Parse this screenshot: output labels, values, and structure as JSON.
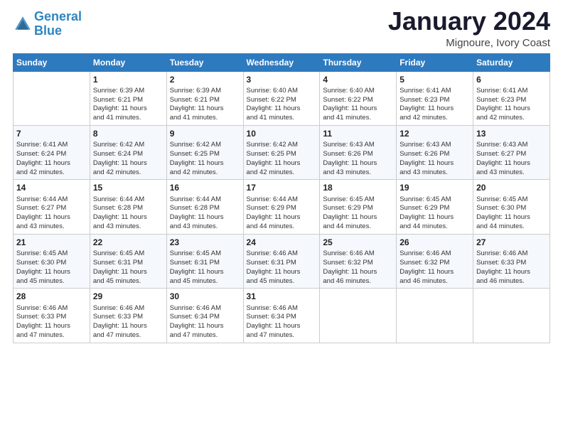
{
  "logo": {
    "line1": "General",
    "line2": "Blue"
  },
  "title": "January 2024",
  "subtitle": "Mignoure, Ivory Coast",
  "days_header": [
    "Sunday",
    "Monday",
    "Tuesday",
    "Wednesday",
    "Thursday",
    "Friday",
    "Saturday"
  ],
  "weeks": [
    [
      {
        "day": "",
        "info": ""
      },
      {
        "day": "1",
        "info": "Sunrise: 6:39 AM\nSunset: 6:21 PM\nDaylight: 11 hours\nand 41 minutes."
      },
      {
        "day": "2",
        "info": "Sunrise: 6:39 AM\nSunset: 6:21 PM\nDaylight: 11 hours\nand 41 minutes."
      },
      {
        "day": "3",
        "info": "Sunrise: 6:40 AM\nSunset: 6:22 PM\nDaylight: 11 hours\nand 41 minutes."
      },
      {
        "day": "4",
        "info": "Sunrise: 6:40 AM\nSunset: 6:22 PM\nDaylight: 11 hours\nand 41 minutes."
      },
      {
        "day": "5",
        "info": "Sunrise: 6:41 AM\nSunset: 6:23 PM\nDaylight: 11 hours\nand 42 minutes."
      },
      {
        "day": "6",
        "info": "Sunrise: 6:41 AM\nSunset: 6:23 PM\nDaylight: 11 hours\nand 42 minutes."
      }
    ],
    [
      {
        "day": "7",
        "info": "Sunrise: 6:41 AM\nSunset: 6:24 PM\nDaylight: 11 hours\nand 42 minutes."
      },
      {
        "day": "8",
        "info": "Sunrise: 6:42 AM\nSunset: 6:24 PM\nDaylight: 11 hours\nand 42 minutes."
      },
      {
        "day": "9",
        "info": "Sunrise: 6:42 AM\nSunset: 6:25 PM\nDaylight: 11 hours\nand 42 minutes."
      },
      {
        "day": "10",
        "info": "Sunrise: 6:42 AM\nSunset: 6:25 PM\nDaylight: 11 hours\nand 42 minutes."
      },
      {
        "day": "11",
        "info": "Sunrise: 6:43 AM\nSunset: 6:26 PM\nDaylight: 11 hours\nand 43 minutes."
      },
      {
        "day": "12",
        "info": "Sunrise: 6:43 AM\nSunset: 6:26 PM\nDaylight: 11 hours\nand 43 minutes."
      },
      {
        "day": "13",
        "info": "Sunrise: 6:43 AM\nSunset: 6:27 PM\nDaylight: 11 hours\nand 43 minutes."
      }
    ],
    [
      {
        "day": "14",
        "info": "Sunrise: 6:44 AM\nSunset: 6:27 PM\nDaylight: 11 hours\nand 43 minutes."
      },
      {
        "day": "15",
        "info": "Sunrise: 6:44 AM\nSunset: 6:28 PM\nDaylight: 11 hours\nand 43 minutes."
      },
      {
        "day": "16",
        "info": "Sunrise: 6:44 AM\nSunset: 6:28 PM\nDaylight: 11 hours\nand 43 minutes."
      },
      {
        "day": "17",
        "info": "Sunrise: 6:44 AM\nSunset: 6:29 PM\nDaylight: 11 hours\nand 44 minutes."
      },
      {
        "day": "18",
        "info": "Sunrise: 6:45 AM\nSunset: 6:29 PM\nDaylight: 11 hours\nand 44 minutes."
      },
      {
        "day": "19",
        "info": "Sunrise: 6:45 AM\nSunset: 6:29 PM\nDaylight: 11 hours\nand 44 minutes."
      },
      {
        "day": "20",
        "info": "Sunrise: 6:45 AM\nSunset: 6:30 PM\nDaylight: 11 hours\nand 44 minutes."
      }
    ],
    [
      {
        "day": "21",
        "info": "Sunrise: 6:45 AM\nSunset: 6:30 PM\nDaylight: 11 hours\nand 45 minutes."
      },
      {
        "day": "22",
        "info": "Sunrise: 6:45 AM\nSunset: 6:31 PM\nDaylight: 11 hours\nand 45 minutes."
      },
      {
        "day": "23",
        "info": "Sunrise: 6:45 AM\nSunset: 6:31 PM\nDaylight: 11 hours\nand 45 minutes."
      },
      {
        "day": "24",
        "info": "Sunrise: 6:46 AM\nSunset: 6:31 PM\nDaylight: 11 hours\nand 45 minutes."
      },
      {
        "day": "25",
        "info": "Sunrise: 6:46 AM\nSunset: 6:32 PM\nDaylight: 11 hours\nand 46 minutes."
      },
      {
        "day": "26",
        "info": "Sunrise: 6:46 AM\nSunset: 6:32 PM\nDaylight: 11 hours\nand 46 minutes."
      },
      {
        "day": "27",
        "info": "Sunrise: 6:46 AM\nSunset: 6:33 PM\nDaylight: 11 hours\nand 46 minutes."
      }
    ],
    [
      {
        "day": "28",
        "info": "Sunrise: 6:46 AM\nSunset: 6:33 PM\nDaylight: 11 hours\nand 47 minutes."
      },
      {
        "day": "29",
        "info": "Sunrise: 6:46 AM\nSunset: 6:33 PM\nDaylight: 11 hours\nand 47 minutes."
      },
      {
        "day": "30",
        "info": "Sunrise: 6:46 AM\nSunset: 6:34 PM\nDaylight: 11 hours\nand 47 minutes."
      },
      {
        "day": "31",
        "info": "Sunrise: 6:46 AM\nSunset: 6:34 PM\nDaylight: 11 hours\nand 47 minutes."
      },
      {
        "day": "",
        "info": ""
      },
      {
        "day": "",
        "info": ""
      },
      {
        "day": "",
        "info": ""
      }
    ]
  ]
}
